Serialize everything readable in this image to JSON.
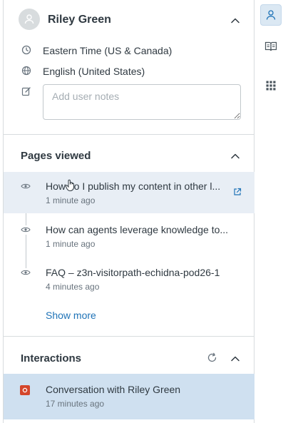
{
  "profile": {
    "name": "Riley Green",
    "timezone": "Eastern Time (US & Canada)",
    "language": "English (United States)",
    "notes_placeholder": "Add user notes"
  },
  "pages_viewed": {
    "title": "Pages viewed",
    "items": [
      {
        "title": "How do I publish my content in other l...",
        "time": "1 minute ago"
      },
      {
        "title": "How can agents leverage knowledge to...",
        "time": "1 minute ago"
      },
      {
        "title": "FAQ – z3n-visitorpath-echidna-pod26-1",
        "time": "4 minutes ago"
      }
    ],
    "show_more": "Show more"
  },
  "interactions": {
    "title": "Interactions",
    "items": [
      {
        "title": "Conversation with Riley Green",
        "time": "17 minutes ago"
      }
    ]
  },
  "colors": {
    "link": "#1f73b7",
    "highlight": "#e8eef5",
    "selected": "#cfe0f0",
    "badge": "#d4462b",
    "rail_active": "#dbe8f3"
  },
  "icons": {
    "rail": [
      "person-icon",
      "book-icon",
      "apps-grid-icon"
    ],
    "profile": [
      "clock-icon",
      "globe-icon",
      "edit-note-icon"
    ],
    "pages": [
      "eye-icon",
      "external-link-icon"
    ],
    "interactions": [
      "refresh-icon",
      "chevron-up-icon",
      "conversation-badge-icon"
    ]
  }
}
